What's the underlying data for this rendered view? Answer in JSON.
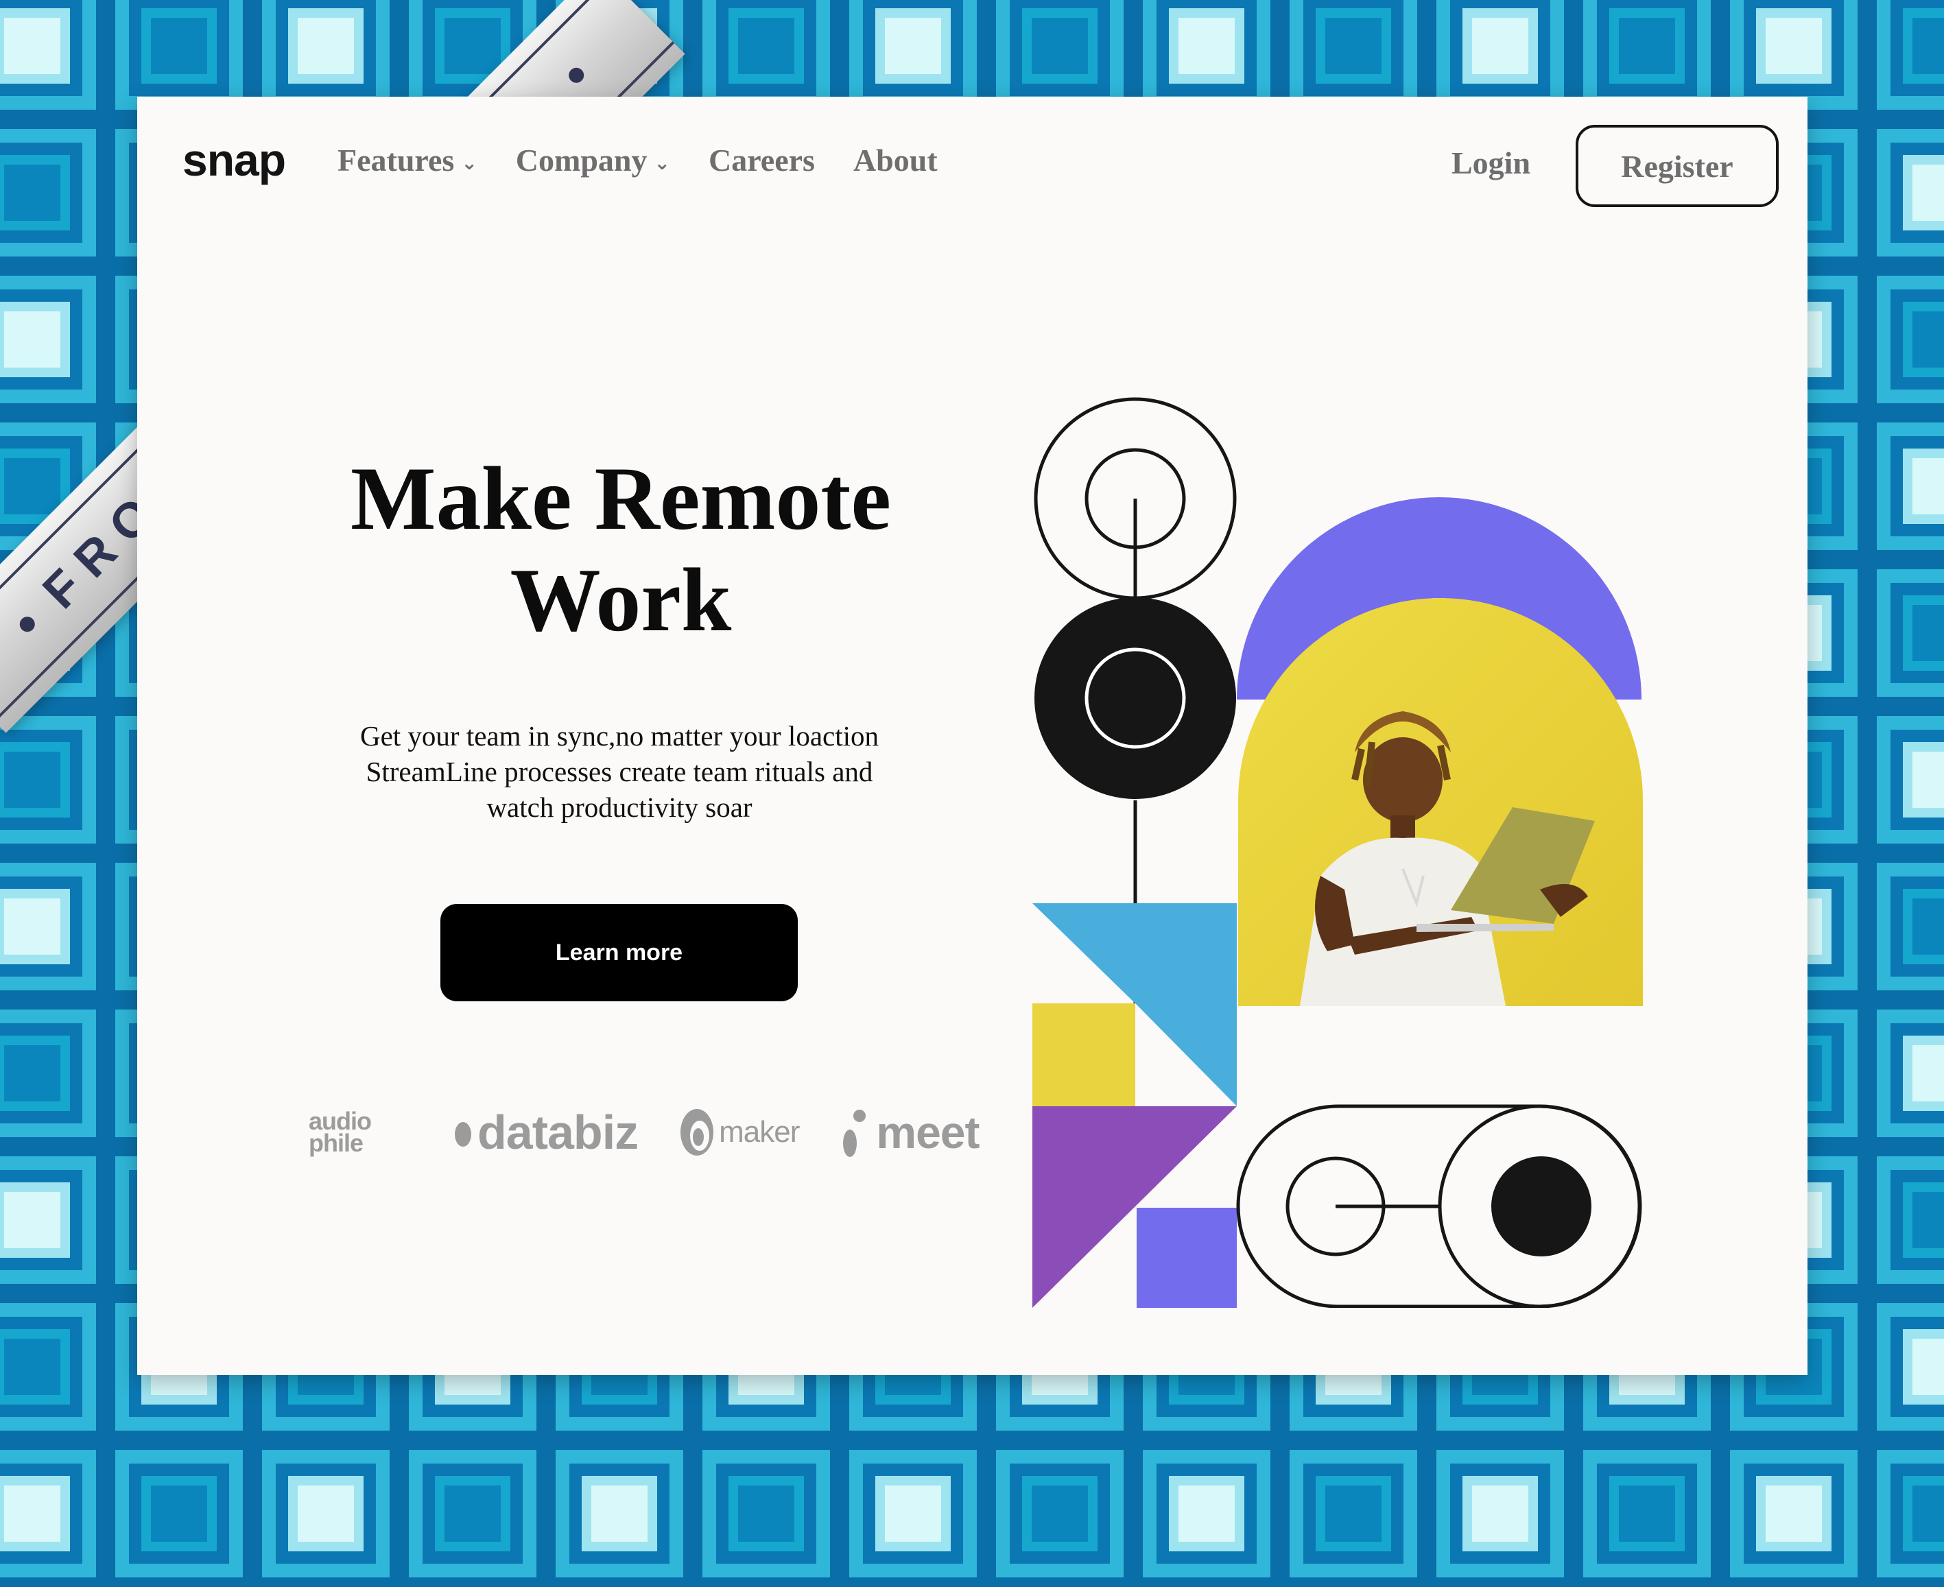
{
  "brand": {
    "logo": "snap"
  },
  "nav": {
    "items": [
      {
        "label": "Features",
        "has_dropdown": true
      },
      {
        "label": "Company",
        "has_dropdown": true
      },
      {
        "label": "Careers",
        "has_dropdown": false
      },
      {
        "label": "About",
        "has_dropdown": false
      }
    ],
    "dropdown_glyph": "⌄"
  },
  "auth": {
    "login_label": "Login",
    "register_label": "Register"
  },
  "hero": {
    "title_line1": "Make Remote",
    "title_line2": "Work",
    "subtitle_line1": "Get your team in sync,no matter your loaction",
    "subtitle_line2": "StreamLine processes create team rituals and",
    "subtitle_line3": "watch productivity soar",
    "cta_label": "Learn more"
  },
  "clients": {
    "audiophile_line1": "audio",
    "audiophile_line2": "phile",
    "databiz": "databiz",
    "maker": "maker",
    "meet": "meet"
  },
  "ribbon": {
    "text": "FRONTEND MENTOR"
  },
  "colors": {
    "purple": "#736ced",
    "yellow": "#e9d33f",
    "blue": "#49aedb",
    "violet": "#8b4eb8",
    "dark": "#161616",
    "card_bg": "#fbfaf8"
  }
}
